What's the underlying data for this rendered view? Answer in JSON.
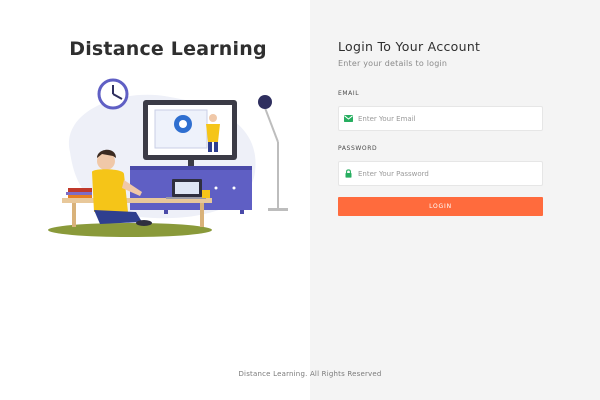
{
  "brand": {
    "title": "Distance Learning"
  },
  "login": {
    "title": "Login To Your Account",
    "subtitle": "Enter your details to login",
    "email_label": "EMAIL",
    "email_placeholder": "Enter Your Email",
    "email_value": "",
    "password_label": "PASSWORD",
    "password_placeholder": "Enter Your Password",
    "password_value": "",
    "button_label": "LOGIN"
  },
  "icons": {
    "email": "envelope-icon",
    "password": "lock-icon"
  },
  "colors": {
    "accent": "#ff6b3d",
    "icon_green": "#27ae60",
    "right_panel_bg": "#f4f4f4",
    "illustration_purple": "#5f5fc4",
    "illustration_yellow": "#f5c518"
  },
  "footer": {
    "text": "Distance Learning. All Rights Reserved"
  }
}
